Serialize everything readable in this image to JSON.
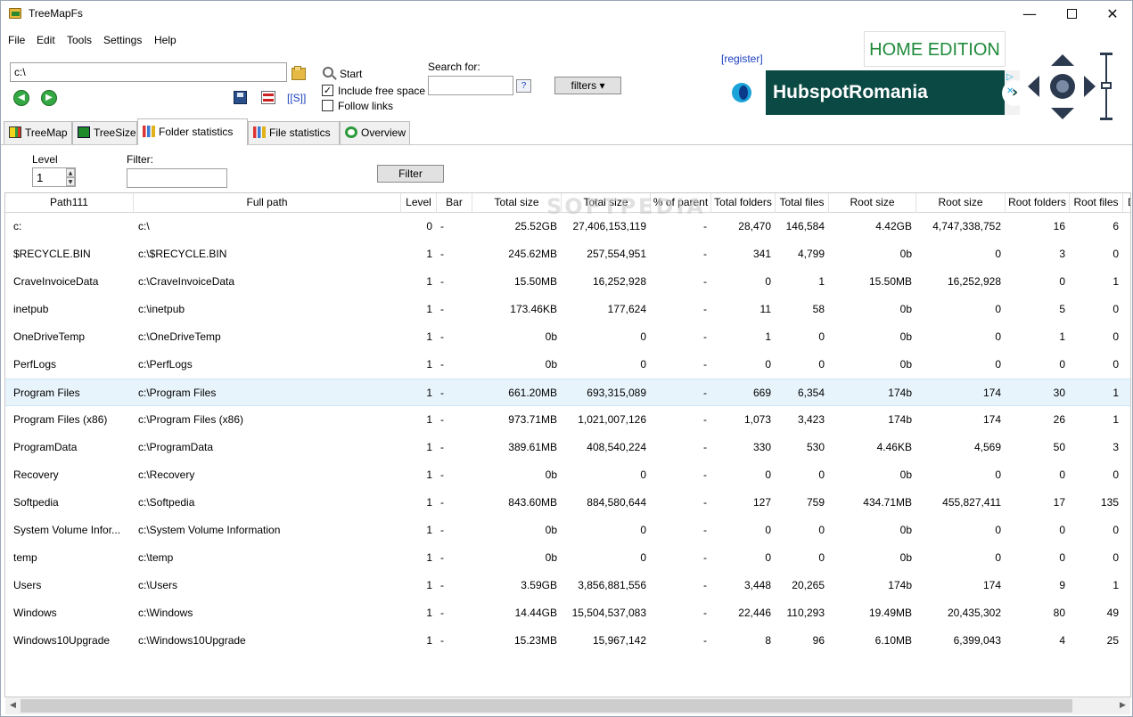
{
  "window": {
    "title": "TreeMapFs",
    "minimize_glyph": "—",
    "close_glyph": "✕"
  },
  "menu": [
    "File",
    "Edit",
    "Tools",
    "Settings",
    "Help"
  ],
  "toolbar": {
    "path_value": "c:\\",
    "start_label": "Start",
    "include_free_space_label": "Include free space",
    "include_free_space_checked": true,
    "follow_links_label": "Follow links",
    "follow_links_checked": false,
    "search_label": "Search for:",
    "search_value": "",
    "help_label": "?",
    "filters_label": "filters ▾",
    "s_link_label": "[[S]]",
    "back_glyph": "◀",
    "forward_glyph": "▶"
  },
  "ad": {
    "register_label": "[register]",
    "edition_label": "HOME EDITION",
    "banner_text": "HubspotRomania",
    "banner_arrow": "›",
    "choices_glyph": "▷",
    "close_glyph": "✕"
  },
  "tabs": [
    {
      "label": "TreeMap",
      "icon": "treemap-icon",
      "active": false
    },
    {
      "label": "TreeSize",
      "icon": "treesize-icon",
      "active": false
    },
    {
      "label": "Folder statistics",
      "icon": "folder-statistics-icon",
      "active": true
    },
    {
      "label": "File statistics",
      "icon": "file-statistics-icon",
      "active": false
    },
    {
      "label": "Overview",
      "icon": "overview-icon",
      "active": false
    }
  ],
  "filter_bar": {
    "level_label": "Level",
    "level_value": "1",
    "filter_label": "Filter:",
    "filter_value": "",
    "filter_button_label": "Filter",
    "spin_up": "▲",
    "spin_down": "▼"
  },
  "grid": {
    "watermark": "SOFTPEDIA",
    "columns": [
      "Path111",
      "Full path",
      "Level",
      "Bar",
      "Total size",
      "Total size",
      "% of parent",
      "Total folders",
      "Total files",
      "Root size",
      "Root size",
      "Root folders",
      "Root files",
      "D"
    ],
    "rows": [
      [
        "c:",
        "c:\\",
        "0",
        "-",
        "25.52GB",
        "27,406,153,119",
        "-",
        "28,470",
        "146,584",
        "4.42GB",
        "4,747,338,752",
        "16",
        "6"
      ],
      [
        "$RECYCLE.BIN",
        "c:\\$RECYCLE.BIN",
        "1",
        "-",
        "245.62MB",
        "257,554,951",
        "-",
        "341",
        "4,799",
        "0b",
        "0",
        "3",
        "0"
      ],
      [
        "CraveInvoiceData",
        "c:\\CraveInvoiceData",
        "1",
        "-",
        "15.50MB",
        "16,252,928",
        "-",
        "0",
        "1",
        "15.50MB",
        "16,252,928",
        "0",
        "1"
      ],
      [
        "inetpub",
        "c:\\inetpub",
        "1",
        "-",
        "173.46KB",
        "177,624",
        "-",
        "11",
        "58",
        "0b",
        "0",
        "5",
        "0"
      ],
      [
        "OneDriveTemp",
        "c:\\OneDriveTemp",
        "1",
        "-",
        "0b",
        "0",
        "-",
        "1",
        "0",
        "0b",
        "0",
        "1",
        "0"
      ],
      [
        "PerfLogs",
        "c:\\PerfLogs",
        "1",
        "-",
        "0b",
        "0",
        "-",
        "0",
        "0",
        "0b",
        "0",
        "0",
        "0"
      ],
      [
        "Program Files",
        "c:\\Program Files",
        "1",
        "-",
        "661.20MB",
        "693,315,089",
        "-",
        "669",
        "6,354",
        "174b",
        "174",
        "30",
        "1"
      ],
      [
        "Program Files (x86)",
        "c:\\Program Files (x86)",
        "1",
        "-",
        "973.71MB",
        "1,021,007,126",
        "-",
        "1,073",
        "3,423",
        "174b",
        "174",
        "26",
        "1"
      ],
      [
        "ProgramData",
        "c:\\ProgramData",
        "1",
        "-",
        "389.61MB",
        "408,540,224",
        "-",
        "330",
        "530",
        "4.46KB",
        "4,569",
        "50",
        "3"
      ],
      [
        "Recovery",
        "c:\\Recovery",
        "1",
        "-",
        "0b",
        "0",
        "-",
        "0",
        "0",
        "0b",
        "0",
        "0",
        "0"
      ],
      [
        "Softpedia",
        "c:\\Softpedia",
        "1",
        "-",
        "843.60MB",
        "884,580,644",
        "-",
        "127",
        "759",
        "434.71MB",
        "455,827,411",
        "17",
        "135"
      ],
      [
        "System Volume Infor...",
        "c:\\System Volume Information",
        "1",
        "-",
        "0b",
        "0",
        "-",
        "0",
        "0",
        "0b",
        "0",
        "0",
        "0"
      ],
      [
        "temp",
        "c:\\temp",
        "1",
        "-",
        "0b",
        "0",
        "-",
        "0",
        "0",
        "0b",
        "0",
        "0",
        "0"
      ],
      [
        "Users",
        "c:\\Users",
        "1",
        "-",
        "3.59GB",
        "3,856,881,556",
        "-",
        "3,448",
        "20,265",
        "174b",
        "174",
        "9",
        "1"
      ],
      [
        "Windows",
        "c:\\Windows",
        "1",
        "-",
        "14.44GB",
        "15,504,537,083",
        "-",
        "22,446",
        "110,293",
        "19.49MB",
        "20,435,302",
        "80",
        "49"
      ],
      [
        "Windows10Upgrade",
        "c:\\Windows10Upgrade",
        "1",
        "-",
        "15.23MB",
        "15,967,142",
        "-",
        "8",
        "96",
        "6.10MB",
        "6,399,043",
        "4",
        "25"
      ]
    ],
    "selected_row": 6
  },
  "scrollbar": {
    "left_glyph": "◀",
    "right_glyph": "▶"
  }
}
